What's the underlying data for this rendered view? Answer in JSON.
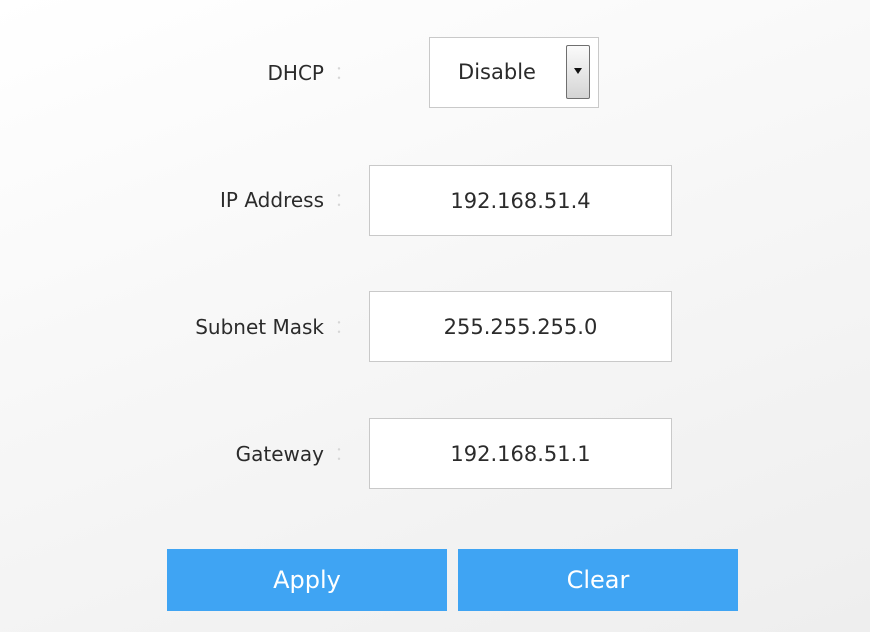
{
  "form": {
    "dhcp": {
      "label": "DHCP",
      "separator": "︰",
      "value": "Disable"
    },
    "ip_address": {
      "label": "IP Address",
      "separator": "︰",
      "value": "192.168.51.4"
    },
    "subnet_mask": {
      "label": "Subnet Mask",
      "separator": "︰",
      "value": "255.255.255.0"
    },
    "gateway": {
      "label": "Gateway",
      "separator": "︰",
      "value": "192.168.51.1"
    }
  },
  "actions": {
    "apply_label": "Apply",
    "clear_label": "Clear"
  },
  "colors": {
    "button": "#3fa4f3",
    "button_text": "#ffffff",
    "label_text": "#2b2b2b"
  },
  "icons": {
    "dropdown": "dropdown-arrow-icon"
  }
}
